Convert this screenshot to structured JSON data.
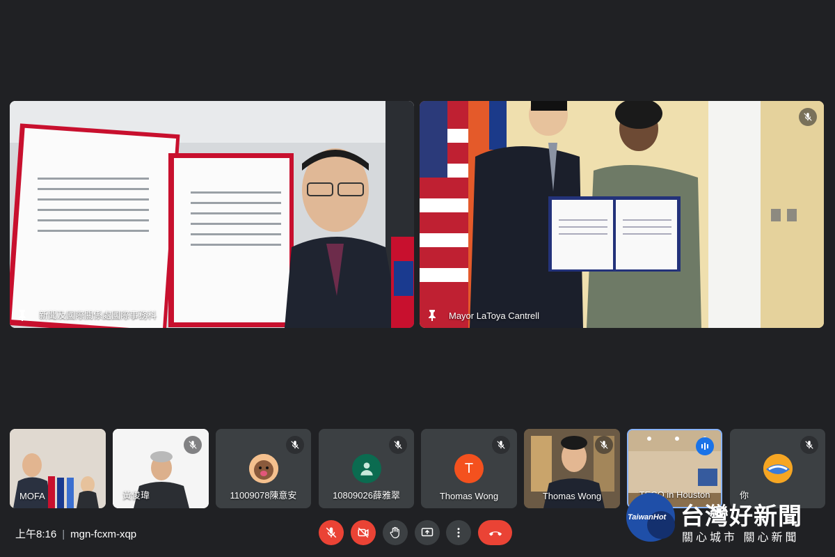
{
  "main_tiles": [
    {
      "name": "新聞及國際關係處國際事務科"
    },
    {
      "name": "Mayor LaToya Cantrell"
    }
  ],
  "thumbnails": [
    {
      "name": "MOFA"
    },
    {
      "name": "黃俊瑋"
    },
    {
      "name": "11009078陳意安"
    },
    {
      "name": "10809026薛雅翠"
    },
    {
      "name": "Thomas Wong",
      "initial": "T"
    },
    {
      "name": "Thomas Wong"
    },
    {
      "name": "TECO in Houston"
    },
    {
      "name": "你"
    }
  ],
  "meeting": {
    "time": "上午8:16",
    "code": "mgn-fcxm-xqp"
  },
  "watermark": {
    "brand": "TaiwanHot",
    "title": "台灣好新聞",
    "subtitle": "關心城市 關心新聞"
  },
  "colors": {
    "background": "#202124",
    "tile": "#3c4043",
    "danger": "#ea4335",
    "active": "#8ab4f8"
  },
  "icons": [
    "pin-icon",
    "mic-off-icon",
    "camera-off-icon",
    "raise-hand-icon",
    "present-icon",
    "more-icon",
    "end-call-icon",
    "speaking-icon"
  ]
}
